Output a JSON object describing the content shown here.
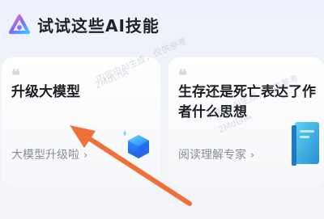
{
  "header": {
    "title": "试试这些AI技能",
    "logo_icon": "ai-assistant-logo-icon"
  },
  "cards": [
    {
      "quote_mark": "❝",
      "prompt": "升级大模型",
      "skill_label": "大模型升级啦",
      "chevron": "›",
      "illustration": "cube-icon"
    },
    {
      "quote_mark": "❝",
      "prompt": "生存还是死亡表达了作者什么思想",
      "skill_label": "阅读理解专家",
      "chevron": "›",
      "illustration": "book-icon"
    }
  ],
  "watermark": {
    "line1": "内容由AI生成，仅供参考",
    "line2": "2MdLnA"
  },
  "annotation": {
    "color": "#f0703a"
  }
}
